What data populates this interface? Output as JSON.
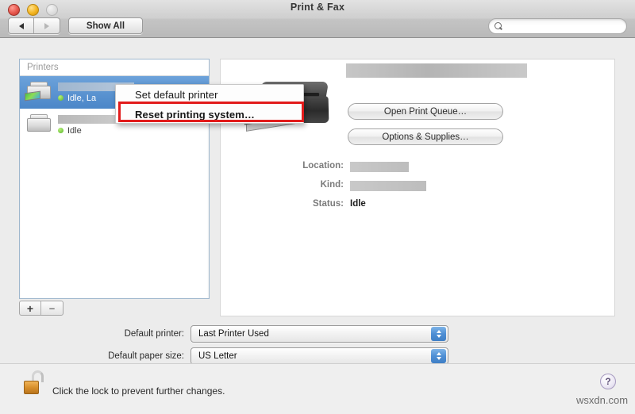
{
  "window": {
    "title": "Print & Fax",
    "traffic_lights": [
      "close",
      "minimize",
      "zoom"
    ]
  },
  "toolbar": {
    "back_label": "back-arrow",
    "forward_label": "forward-arrow",
    "show_all_label": "Show All",
    "search": {
      "value": "",
      "placeholder": ""
    }
  },
  "printer_list": {
    "header": "Printers",
    "items": [
      {
        "name_redacted": true,
        "name_bar_width": 96,
        "status": "Idle, La",
        "selected": true
      },
      {
        "name_redacted": true,
        "name_bar_width": 88,
        "status": "Idle",
        "selected": false
      }
    ],
    "add_label": "+",
    "remove_label": "–"
  },
  "context_menu": {
    "items": [
      {
        "label": "Set default printer",
        "highlighted": false
      },
      {
        "label": "Reset printing system…",
        "highlighted": true
      }
    ],
    "highlight_color": "#e21b1b"
  },
  "detail": {
    "printer_name_redacted": true,
    "buttons": [
      {
        "label": "Open Print Queue…"
      },
      {
        "label": "Options & Supplies…"
      }
    ],
    "fields": [
      {
        "label": "Location:",
        "value": "",
        "redacted": true,
        "redact_width": 74
      },
      {
        "label": "Kind:",
        "value": "",
        "redacted": true,
        "redact_width": 96
      },
      {
        "label": "Status:",
        "value": "Idle",
        "redacted": false,
        "redact_width": 0
      }
    ]
  },
  "defaults": {
    "printer": {
      "label": "Default printer:",
      "value": "Last Printer Used"
    },
    "paper_size": {
      "label": "Default paper size:",
      "value": "US Letter"
    }
  },
  "footer": {
    "lock_state": "unlocked",
    "lock_text": "Click the lock to prevent further changes.",
    "help_label": "?",
    "watermark": "wsxdn.com"
  }
}
